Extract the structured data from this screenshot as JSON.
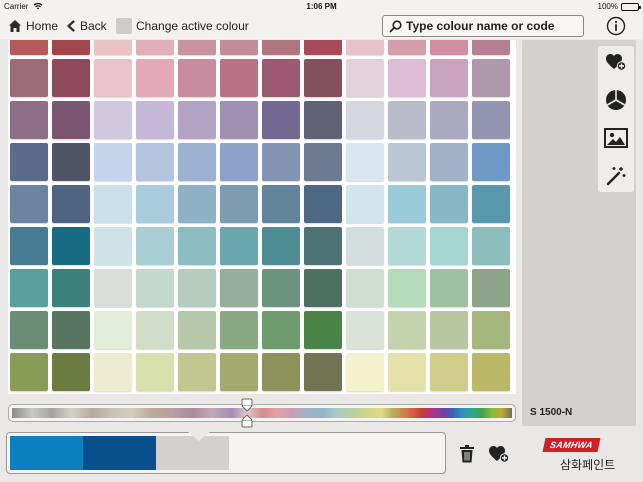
{
  "status_bar": {
    "carrier": "Carrier",
    "time": "1:06 PM",
    "battery": "100%"
  },
  "toolbar": {
    "home_label": "Home",
    "back_label": "Back",
    "change_label": "Change active colour",
    "search_placeholder": "Type colour name or code"
  },
  "grid": {
    "columns": 12,
    "rows": [
      [
        "#b55a5b",
        "#a2474c",
        "#e8c2c4",
        "#e0b0b9",
        "#c8929f",
        "#c48b98",
        "#b0767f",
        "#a84a58",
        "#e6c3cc",
        "#d49ead",
        "#cf8ea2",
        "#b67f92"
      ],
      [
        "#9c6b78",
        "#8c4a5c",
        "#e8c3cc",
        "#e2a9b9",
        "#c98ba0",
        "#b77288",
        "#9c5a72",
        "#84505f",
        "#e4d1dc",
        "#dcbdd4",
        "#c9a2bd",
        "#ad99aa"
      ],
      [
        "#8e6d86",
        "#7c5570",
        "#d0c7dc",
        "#c5b8d6",
        "#b2a3c4",
        "#9f8fb1",
        "#736891",
        "#636178",
        "#d5d6e0",
        "#b9bbcb",
        "#a9a9c2",
        "#9395ae"
      ],
      [
        "#5c6b8a",
        "#4f5564",
        "#c5d4ea",
        "#b4c4de",
        "#9cb0cf",
        "#8ca2ca",
        "#8493b2",
        "#6c7b91",
        "#d8e6f0",
        "#b9c6d3",
        "#a1b2c6",
        "#6e99c4"
      ],
      [
        "#6d84a0",
        "#4f6480",
        "#c9dfe9",
        "#a9cbdb",
        "#8fb1c6",
        "#7d9cb0",
        "#62849a",
        "#4c6883",
        "#d2e4ec",
        "#9acbd8",
        "#87b6c4",
        "#5898ac"
      ],
      [
        "#477b91",
        "#176c83",
        "#cfe3e6",
        "#a9cfd4",
        "#8bbcc2",
        "#6aa6ad",
        "#4f8b93",
        "#4c7274",
        "#d3dddd",
        "#b3d9d6",
        "#a4d6cf",
        "#8dbcbd"
      ],
      [
        "#5a9e9e",
        "#3b807b",
        "#d8ddd8",
        "#c3d9cd",
        "#b4cbbd",
        "#94ad9c",
        "#6b937f",
        "#4e7060",
        "#cfdfcf",
        "#b5dbbb",
        "#9ec2a1",
        "#8ea48a"
      ],
      [
        "#6b8d74",
        "#577560",
        "#e1edd7",
        "#d1ddc7",
        "#b5c8aa",
        "#89a982",
        "#6f9c6f",
        "#4a8346",
        "#dbe2d6",
        "#c5d2ae",
        "#b9c7a0",
        "#a5b77d"
      ],
      [
        "#889b57",
        "#6c7c40",
        "#ecebd0",
        "#d8e0ad",
        "#c2c78f",
        "#a3aa6e",
        "#8c9259",
        "#707452",
        "#f3f2cd",
        "#e4e2a9",
        "#cfcd8c",
        "#bbb868"
      ],
      [
        "#9aa255",
        "#8c8e3a",
        "#f0ecc2",
        "#e2dca0",
        "#cfc47b",
        "#b5ab5c",
        "#9a9146",
        "#7f7a3e",
        "#f4efc4",
        "#e9dea0",
        "#d9c97d",
        "#c4b15c"
      ]
    ]
  },
  "right_panel": {
    "color_code": "S 1500-N",
    "tools": [
      "heart-add-icon",
      "color-wheel-icon",
      "image-icon",
      "magic-wand-icon"
    ]
  },
  "slider": {
    "position": 0.47
  },
  "palette": {
    "swatches": [
      "#0c7fbe",
      "#0a4f8d",
      "#d3d1ce"
    ]
  },
  "brand": {
    "logo": "SAMHWA",
    "korean": "삼화페인트"
  },
  "colors": {
    "panel": "#d3d1ce",
    "toolbar": "#f3f2f0",
    "brand_red": "#cf1f27"
  }
}
